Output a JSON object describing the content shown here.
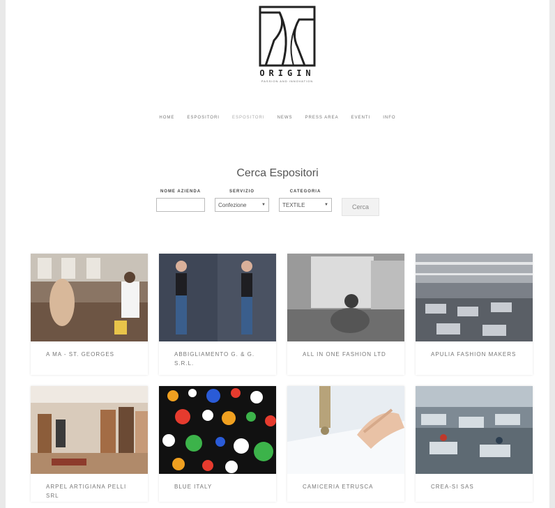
{
  "logo": {
    "word": "ORIGIN",
    "tagline": "PASSION AND INNOVATION"
  },
  "nav": [
    {
      "label": "HOME",
      "active": false
    },
    {
      "label": "ESPOSITORI",
      "active": false
    },
    {
      "label": "ESPOSITORI",
      "active": true
    },
    {
      "label": "NEWS",
      "active": false
    },
    {
      "label": "PRESS AREA",
      "active": false
    },
    {
      "label": "EVENTI",
      "active": false
    },
    {
      "label": "INFO",
      "active": false
    }
  ],
  "search": {
    "title": "Cerca Espositori",
    "name_label": "NOME AZIENDA",
    "name_value": "",
    "service_label": "SERVIZIO",
    "service_value": "Confezione",
    "category_label": "CATEGORIA",
    "category_value": "TEXTILE",
    "button_label": "Cerca"
  },
  "exhibitors": [
    {
      "name": "A MA - ST. GEORGES",
      "image": "workshop-photo"
    },
    {
      "name": "ABBIGLIAMENTO G. & G. S.R.L.",
      "image": "models-photo"
    },
    {
      "name": "ALL IN ONE FASHION LTD",
      "image": "vintage-factory-photo"
    },
    {
      "name": "APULIA FASHION MAKERS",
      "image": "factory-floor-photo"
    },
    {
      "name": "ARPEL ARTIGIANA PELLI SRL",
      "image": "showroom-photo"
    },
    {
      "name": "BLUE ITALY",
      "image": "polka-dot-fabric-photo"
    },
    {
      "name": "CAMICERIA ETRUSCA",
      "image": "sewing-photo"
    },
    {
      "name": "CREA-SI SAS",
      "image": "sewing-workshop-photo"
    }
  ]
}
